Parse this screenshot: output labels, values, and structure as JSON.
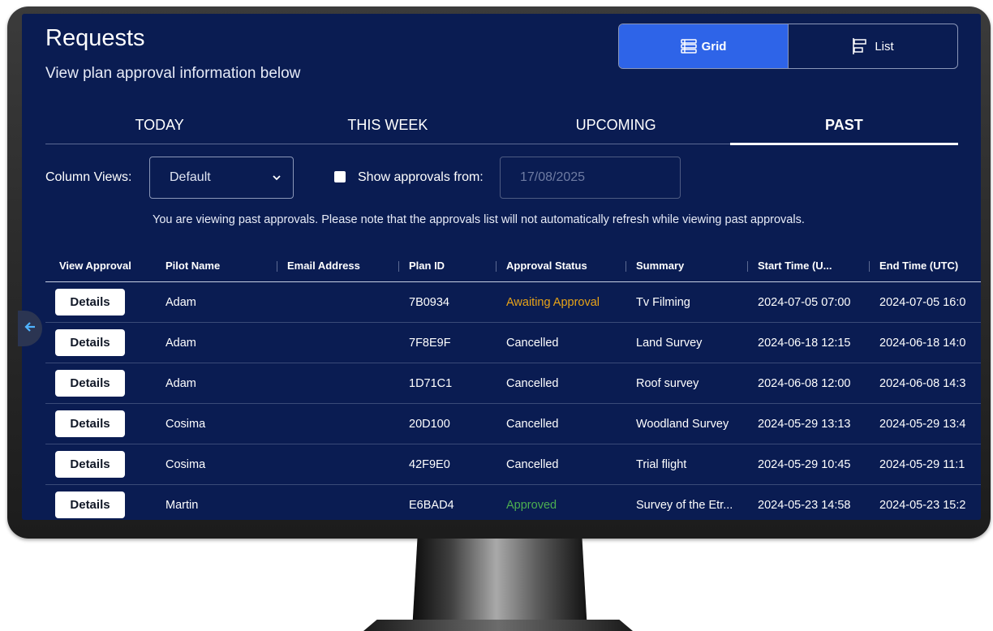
{
  "header": {
    "title": "Requests",
    "subtitle": "View plan approval information below"
  },
  "view_toggle": {
    "grid_label": "Grid",
    "list_label": "List",
    "active": "Grid",
    "grid_icon": "grid-list-icon",
    "list_icon": "list-layout-icon"
  },
  "tabs": [
    {
      "label": "TODAY"
    },
    {
      "label": "THIS WEEK"
    },
    {
      "label": "UPCOMING"
    },
    {
      "label": "PAST"
    }
  ],
  "active_tab": "PAST",
  "filters": {
    "column_views_label": "Column Views:",
    "column_views_value": "Default",
    "show_approvals_label": "Show approvals from:",
    "show_approvals_checked": false,
    "date_placeholder": "17/08/2025"
  },
  "notice": "You are viewing past approvals. Please note that the approvals list will not automatically refresh while viewing past approvals.",
  "table": {
    "headers": [
      "View Approval",
      "Pilot Name",
      "Email Address",
      "Plan ID",
      "Approval Status",
      "Summary",
      "Start Time (U...",
      "End Time (UTC)"
    ],
    "details_label": "Details",
    "rows": [
      {
        "pilot": "Adam",
        "email": "",
        "plan_id": "7B0934",
        "status": "Awaiting Approval",
        "summary": "Tv Filming",
        "start": "2024-07-05 07:00",
        "end": "2024-07-05 16:0"
      },
      {
        "pilot": "Adam",
        "email": "",
        "plan_id": "7F8E9F",
        "status": "Cancelled",
        "summary": "Land Survey",
        "start": "2024-06-18 12:15",
        "end": "2024-06-18 14:0"
      },
      {
        "pilot": "Adam",
        "email": "",
        "plan_id": "1D71C1",
        "status": "Cancelled",
        "summary": "Roof survey",
        "start": "2024-06-08 12:00",
        "end": "2024-06-08 14:3"
      },
      {
        "pilot": "Cosima",
        "email": "",
        "plan_id": "20D100",
        "status": "Cancelled",
        "summary": "Woodland Survey",
        "start": "2024-05-29 13:13",
        "end": "2024-05-29 13:4"
      },
      {
        "pilot": "Cosima",
        "email": "",
        "plan_id": "42F9E0",
        "status": "Cancelled",
        "summary": "Trial flight",
        "start": "2024-05-29 10:45",
        "end": "2024-05-29 11:1"
      },
      {
        "pilot": "Martin",
        "email": "",
        "plan_id": "E6BAD4",
        "status": "Approved",
        "summary": "Survey of the Etr...",
        "start": "2024-05-23 14:58",
        "end": "2024-05-23 15:2"
      }
    ]
  },
  "colors": {
    "screen_bg": "#0a1c52",
    "active_button": "#2e64e8",
    "status_awaiting": "#e8a317",
    "status_approved": "#4caf50",
    "status_cancelled": "#ffffff"
  },
  "side_nav_icon": "arrow-left-icon"
}
